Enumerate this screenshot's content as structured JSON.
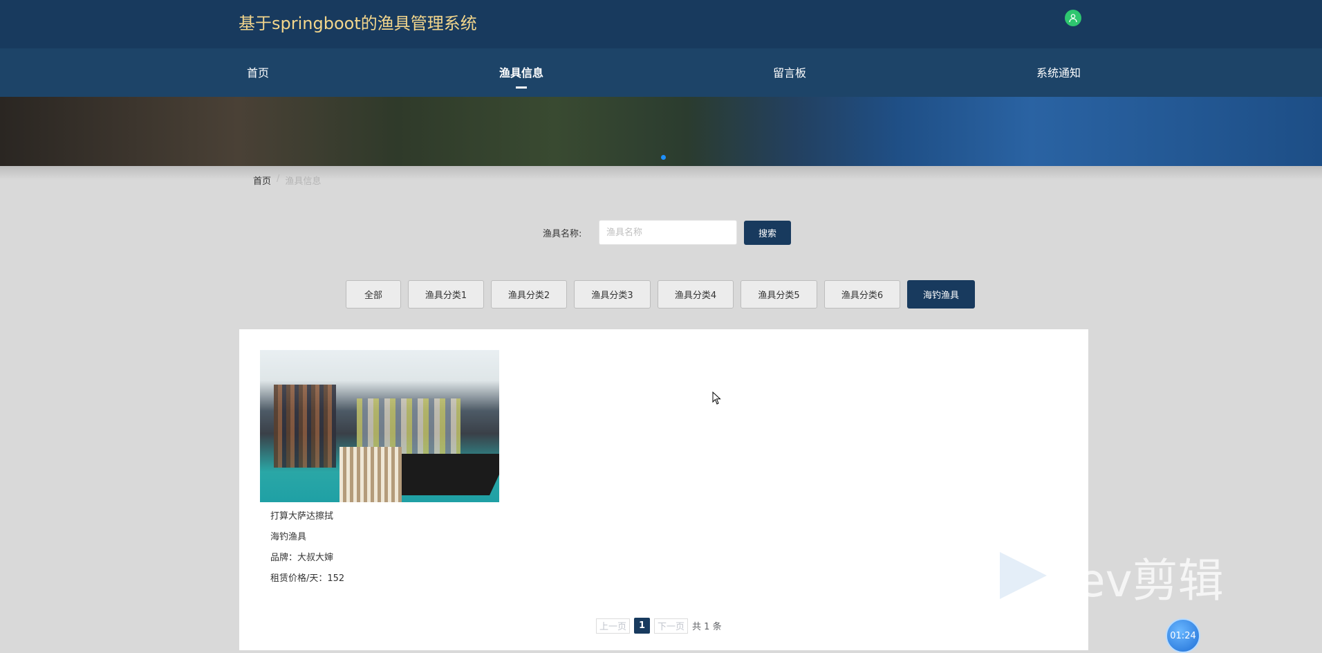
{
  "header": {
    "app_title": "基于springboot的渔具管理系统",
    "user_icon": "user-icon"
  },
  "nav": {
    "items": [
      {
        "label": "首页",
        "active": false
      },
      {
        "label": "渔具信息",
        "active": true
      },
      {
        "label": "留言板",
        "active": false
      },
      {
        "label": "系统通知",
        "active": false
      }
    ]
  },
  "breadcrumb": {
    "home": "首页",
    "separator": "/",
    "current": "渔具信息"
  },
  "search": {
    "label": "渔具名称:",
    "placeholder": "渔具名称",
    "value": "",
    "button_label": "搜索"
  },
  "categories": [
    {
      "label": "全部",
      "active": false
    },
    {
      "label": "渔具分类1",
      "active": false
    },
    {
      "label": "渔具分类2",
      "active": false
    },
    {
      "label": "渔具分类3",
      "active": false
    },
    {
      "label": "渔具分类4",
      "active": false
    },
    {
      "label": "渔具分类5",
      "active": false
    },
    {
      "label": "渔具分类6",
      "active": false
    },
    {
      "label": "海钓渔具",
      "active": true
    }
  ],
  "items": [
    {
      "name": "打算大萨达擦拭",
      "category": "海钓渔具",
      "brand": "品牌：大叔大婶",
      "price": "租赁价格/天：152"
    }
  ],
  "pagination": {
    "prev_label": "上一页",
    "current_page": "1",
    "next_label": "下一页",
    "total_text": "共 1 条"
  },
  "overlay": {
    "watermark_text": "ev剪辑",
    "timer": "01:24"
  },
  "colors": {
    "header_bg": "#183a5e",
    "nav_bg": "#1d4468",
    "title_color": "#f3d68c",
    "accent": "#183a5e",
    "user_icon_bg": "#2ec66f"
  }
}
